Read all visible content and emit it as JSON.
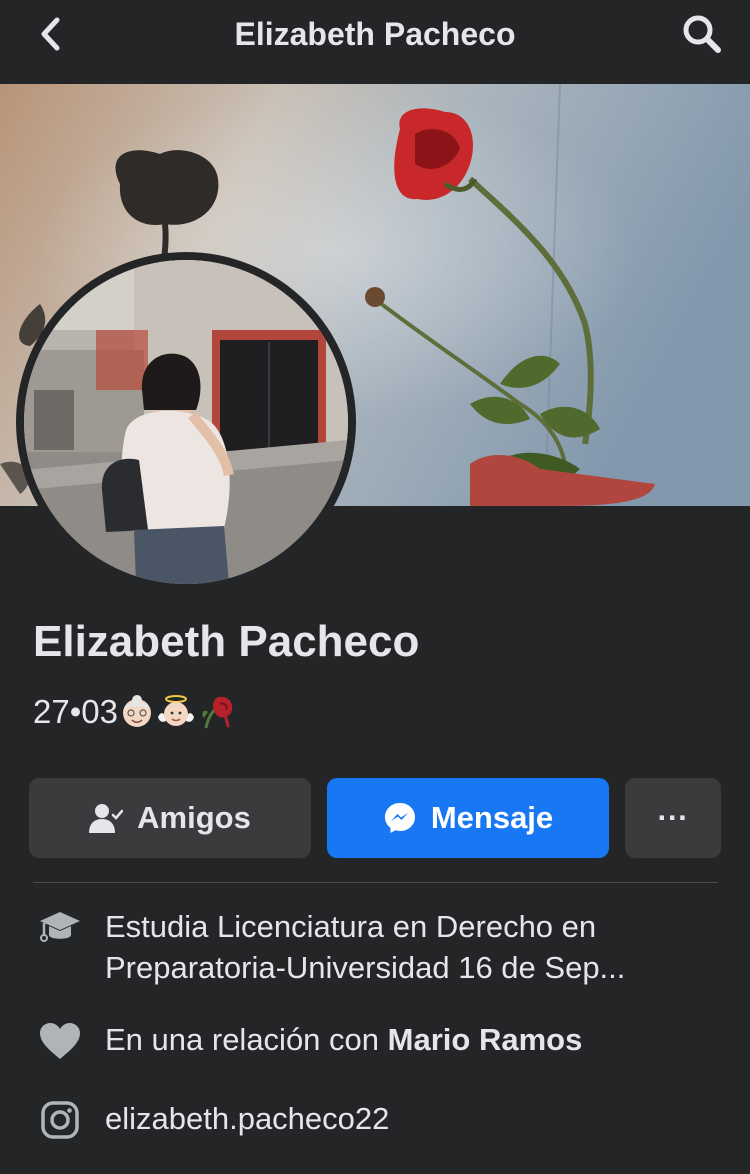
{
  "header": {
    "title": "Elizabeth Pacheco",
    "back_icon": "chevron-left-icon",
    "search_icon": "search-icon"
  },
  "profile": {
    "name": "Elizabeth Pacheco",
    "bio_text": "27•03",
    "bio_emojis": [
      "old-woman-emoji",
      "angel-baby-emoji",
      "wilted-rose-emoji"
    ]
  },
  "actions": {
    "friends_label": "Amigos",
    "message_label": "Mensaje",
    "more_label": "···"
  },
  "details": {
    "education": "Estudia Licenciatura en Derecho en Preparatoria-Universidad 16 de Sep...",
    "relationship_prefix": "En una relación con",
    "relationship_partner": "Mario Ramos",
    "instagram": "elizabeth.pacheco22"
  },
  "colors": {
    "background": "#242526",
    "button_secondary": "#3a3b3c",
    "button_primary": "#1877f2",
    "text": "#e4e6eb",
    "icon_gray": "#b0b3b8"
  }
}
